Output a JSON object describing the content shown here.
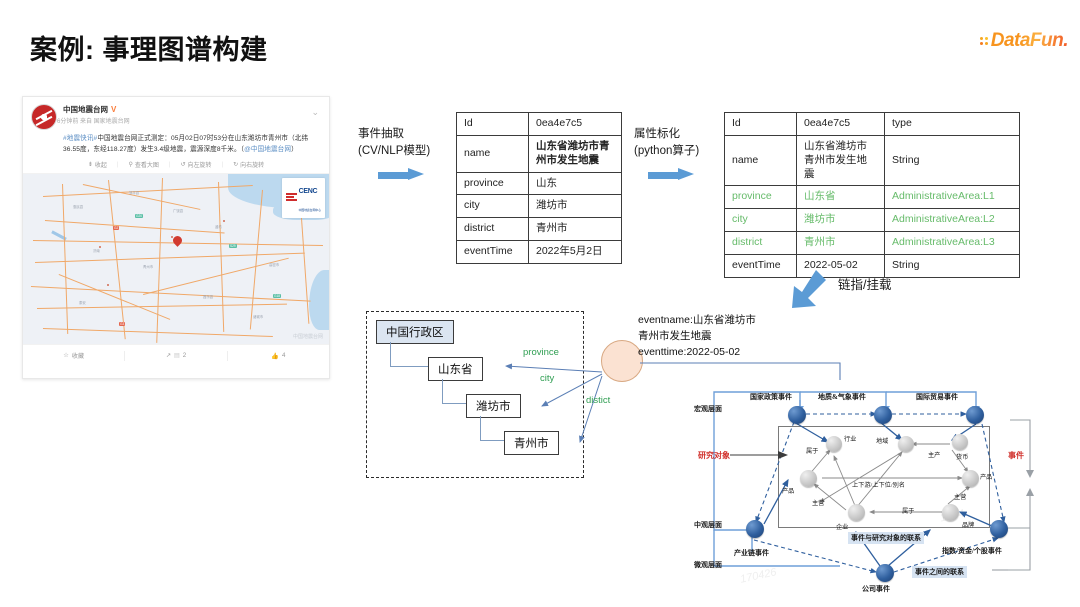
{
  "page": {
    "title": "案例: 事理图谱构建",
    "brand": "DataFun.",
    "accent_blue": "#5b9bd5",
    "accent_green": "#66bb6a",
    "accent_red": "#d1332e"
  },
  "weibo": {
    "account": "中国地震台网",
    "verified_badge": "V",
    "meta": "6分钟前 来自 国家地震台网",
    "hashtag": "#地震快讯#",
    "text_main": "中国地震台网正式测定：05月02日07时53分在山东潍坊市青州市（北纬36.55度，东经118.27度）发生3.4级地震，震源深度8千米。（",
    "text_mention": "@中国地震台网",
    "text_tail": "）",
    "caret_icon": "chevron-down-icon",
    "tools": [
      {
        "icon": "collapse-icon",
        "label": "收起"
      },
      {
        "icon": "search-icon",
        "label": "查看大图"
      },
      {
        "icon": "rotate-left-icon",
        "label": "向左旋转"
      },
      {
        "icon": "rotate-right-icon",
        "label": "向右旋转"
      }
    ],
    "map": {
      "pin": "location-pin-icon",
      "badge_en": "CENC",
      "badge_cn": "中国地震台网中心",
      "watermark": "中国地震台网"
    },
    "footer": {
      "favorite_icon": "star-icon",
      "favorite_label": "收藏",
      "share_icon": "share-icon",
      "comment_count": "2",
      "like_icon": "thumbs-up-icon",
      "like_count": "4"
    }
  },
  "flow": {
    "step1_title": "事件抽取",
    "step1_sub": "(CV/NLP模型)",
    "step2_title": "属性标化",
    "step2_sub": "(python算子)",
    "step3_title": "链指/挂载"
  },
  "table_extracted": {
    "rows": [
      {
        "key": "Id",
        "value": "0ea4e7c5",
        "bold": false
      },
      {
        "key": "name",
        "value": "山东省潍坊市青州市发生地震",
        "bold": true
      },
      {
        "key": "province",
        "value": "山东",
        "bold": false
      },
      {
        "key": "city",
        "value": "潍坊市",
        "bold": false
      },
      {
        "key": "district",
        "value": "青州市",
        "bold": false
      },
      {
        "key": "eventTime",
        "value": "2022年5月2日",
        "bold": false
      }
    ]
  },
  "table_normalized": {
    "rows": [
      {
        "key": "Id",
        "value": "0ea4e7c5",
        "type": "type",
        "green": false
      },
      {
        "key": "name",
        "value": "山东省潍坊市青州市发生地震",
        "type": "String",
        "green": false
      },
      {
        "key": "province",
        "value": "山东省",
        "type": "AdministrativeArea:L1",
        "green": true
      },
      {
        "key": "city",
        "value": "潍坊市",
        "type": "AdministrativeArea:L2",
        "green": true
      },
      {
        "key": "district",
        "value": "青州市",
        "type": "AdministrativeArea:L3",
        "green": true
      },
      {
        "key": "eventTime",
        "value": "2022-05-02",
        "type": "String",
        "green": false
      }
    ]
  },
  "hierarchy": {
    "root": "中国行政区",
    "level1": "山东省",
    "level2": "潍坊市",
    "level3": "青州市",
    "edge_province": "province",
    "edge_city": "city",
    "edge_district": "distict"
  },
  "event_node": {
    "line1": "eventname:山东省潍坊市",
    "line2": "青州市发生地震",
    "line3": "eventtime:2022-05-02"
  },
  "knowledge_graph": {
    "layers": {
      "macro": "宏观层面",
      "meso": "中观层面",
      "micro": "微观层面"
    },
    "subject_label": "研究对象",
    "event_label": "事件",
    "macro_events": [
      "国家政策事件",
      "地质&气象事件",
      "国际贸易事件"
    ],
    "micro_events": [
      "产业链事件",
      "指数/资金/个股事件",
      "公司事件"
    ],
    "inner_nodes": [
      "行业",
      "地域",
      "货币",
      "产品",
      "产品",
      "企业",
      "品牌"
    ],
    "inner_edges": [
      "属于",
      "主产",
      "上下游/上下位/别名",
      "主营",
      "主营",
      "属于"
    ],
    "relation_event_subject": "事件与研究对象的联系",
    "relation_event_event": "事件之间的联系"
  }
}
